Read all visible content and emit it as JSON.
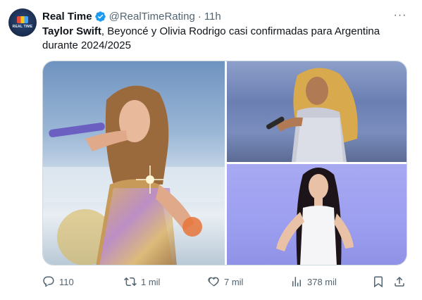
{
  "tweet": {
    "author_name": "Real Time",
    "handle": "@RealTimeRating",
    "separator": "·",
    "time": "11h",
    "text_bold": "Taylor Swift",
    "text_rest": ", Beyoncé y Olivia Rodrigo casi confirmadas para Argentina durante 2024/2025",
    "avatar_text": "REAL TIME",
    "more_label": "···"
  },
  "media": {
    "images": [
      {
        "subject": "Taylor Swift singing on stage"
      },
      {
        "subject": "Beyoncé in silver outfit on stage"
      },
      {
        "subject": "Olivia Rodrigo posing on purple background"
      }
    ]
  },
  "actions": {
    "replies": "110",
    "retweets": "1 mil",
    "likes": "7 mil",
    "views": "378 mil"
  },
  "colors": {
    "verified_badge": "#1d9bf0",
    "secondary_text": "#536471",
    "primary_text": "#0f1419"
  },
  "icons": [
    "verified-badge-icon",
    "more-icon",
    "reply-icon",
    "retweet-icon",
    "like-icon",
    "views-icon",
    "bookmark-icon",
    "share-icon"
  ]
}
